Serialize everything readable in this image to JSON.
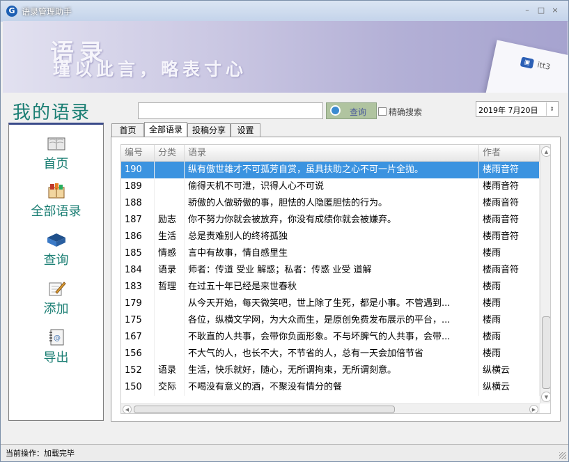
{
  "window": {
    "title": "语录管理助手",
    "icon_letter": "G",
    "buttons": {
      "minimize": "–",
      "maximize": "□",
      "close": "×"
    }
  },
  "banner": {
    "line1": "语录",
    "line2": "瑾以此言，略表寸心",
    "card_text": "itt3"
  },
  "page_title": "我的语录",
  "sidebar": {
    "items": [
      {
        "label": "首页",
        "icon": "book-open-icon"
      },
      {
        "label": "全部语录",
        "icon": "books-icon"
      },
      {
        "label": "查询",
        "icon": "search-book-icon"
      },
      {
        "label": "添加",
        "icon": "edit-pencil-icon"
      },
      {
        "label": "导出",
        "icon": "address-book-icon"
      }
    ]
  },
  "search": {
    "value": "",
    "button_label": "查询",
    "exact_label": "精确搜索",
    "exact_checked": false
  },
  "date_picker": {
    "value": "2019年 7月20日",
    "spin": "⇕"
  },
  "tabs": [
    {
      "label": "首页",
      "active": false
    },
    {
      "label": "全部语录",
      "active": true
    },
    {
      "label": "投稿分享",
      "active": false
    },
    {
      "label": "设置",
      "active": false
    }
  ],
  "grid": {
    "columns": [
      "编号",
      "分类",
      "语录",
      "作者"
    ],
    "rows": [
      {
        "id": "190",
        "category": "",
        "quote": "纵有傲世雄才不可孤芳自赏，虽具扶助之心不可一片全抛。",
        "author": "楼雨音符",
        "selected": true
      },
      {
        "id": "189",
        "category": "",
        "quote": "偷得天机不可泄，识得人心不可说",
        "author": "楼雨音符",
        "selected": false
      },
      {
        "id": "188",
        "category": "",
        "quote": "骄傲的人做骄傲的事，胆怯的人隐匿胆怯的行为。",
        "author": "楼雨音符",
        "selected": false
      },
      {
        "id": "187",
        "category": "励志",
        "quote": "你不努力你就会被放弃，你没有成绩你就会被嫌弃。",
        "author": "楼雨音符",
        "selected": false
      },
      {
        "id": "186",
        "category": "生活",
        "quote": "总是责难别人的终将孤独",
        "author": "楼雨音符",
        "selected": false
      },
      {
        "id": "185",
        "category": "情感",
        "quote": "言中有故事，情自感里生",
        "author": "楼雨",
        "selected": false
      },
      {
        "id": "184",
        "category": "语录",
        "quote": "师者：传道 受业 解惑；私者：传惑 业受 道解",
        "author": "楼雨音符",
        "selected": false
      },
      {
        "id": "183",
        "category": "哲理",
        "quote": "在过五十年已经是来世春秋",
        "author": "楼雨",
        "selected": false
      },
      {
        "id": "179",
        "category": "",
        "quote": "从今天开始，每天微笑吧，世上除了生死，都是小事。不管遇到...",
        "author": "楼雨",
        "selected": false
      },
      {
        "id": "175",
        "category": "",
        "quote": "各位，纵横文学网，为大众而生，是原创免费发布展示的平台，...",
        "author": "楼雨",
        "selected": false
      },
      {
        "id": "167",
        "category": "",
        "quote": "不耿直的人共事，会带你负面形象。不与坏脾气的人共事，会带...",
        "author": "楼雨",
        "selected": false
      },
      {
        "id": "156",
        "category": "",
        "quote": "不大气的人，也长不大，不节省的人，总有一天会加倍节省",
        "author": "楼雨",
        "selected": false
      },
      {
        "id": "152",
        "category": "语录",
        "quote": "生活，快乐就好，随心，无所谓拘束，无所谓刻意。",
        "author": "纵横云",
        "selected": false
      },
      {
        "id": "150",
        "category": "交际",
        "quote": "不喝没有意义的酒，不聚没有情分的餐",
        "author": "纵横云",
        "selected": false
      }
    ]
  },
  "scroll": {
    "up": "▲",
    "down": "▼",
    "left": "◀",
    "right": "▶"
  },
  "status": {
    "text": "当前操作：加载完毕"
  },
  "colors": {
    "accent_teal": "#1a7e73",
    "selection_blue": "#3b93e0",
    "banner_purple": "#b3b0d6"
  }
}
